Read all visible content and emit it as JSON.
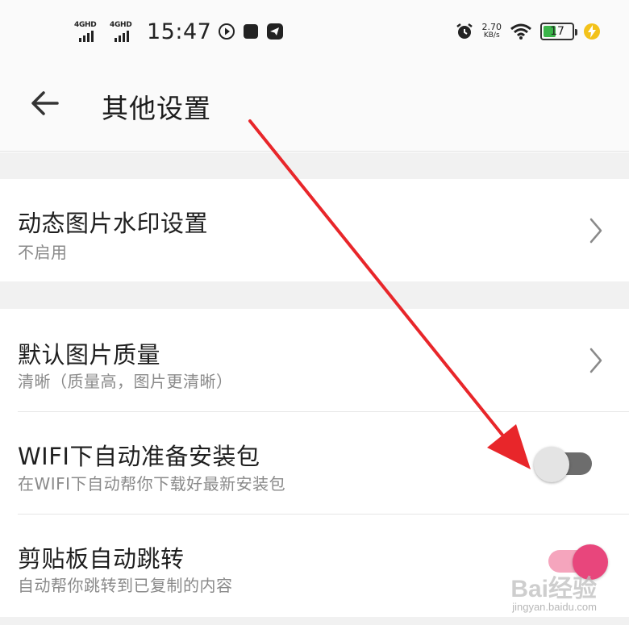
{
  "status_bar": {
    "network_1": "4GHD",
    "network_2": "4GHD",
    "time": "15:47",
    "speed_value": "2.70",
    "speed_unit": "KB/s",
    "battery_level": "17",
    "icons": [
      "play-icon",
      "stop-icon",
      "telegram-icon",
      "alarm-icon",
      "wifi-icon",
      "battery-icon",
      "charging-icon"
    ]
  },
  "header": {
    "title": "其他设置",
    "back_icon": "back-arrow-icon"
  },
  "settings": [
    {
      "title": "动态图片水印设置",
      "subtitle": "不启用",
      "control": "chevron"
    },
    {
      "title": "默认图片质量",
      "subtitle": "清晰（质量高，图片更清晰）",
      "control": "chevron"
    },
    {
      "title": "WIFI下自动准备安装包",
      "subtitle": "在WIFI下自动帮你下载好最新安装包",
      "control": "toggle",
      "enabled": false
    },
    {
      "title": "剪贴板自动跳转",
      "subtitle": "自动帮你跳转到已复制的内容",
      "control": "toggle",
      "enabled": true
    }
  ],
  "watermark": {
    "text": "Bai经验",
    "sub": "jingyan.baidu.com"
  },
  "colors": {
    "toggle_on_knob": "#e8467c",
    "toggle_on_track": "#f5a5bd",
    "toggle_off_track": "#6d6d6d",
    "annotation_arrow": "#e8262a"
  }
}
